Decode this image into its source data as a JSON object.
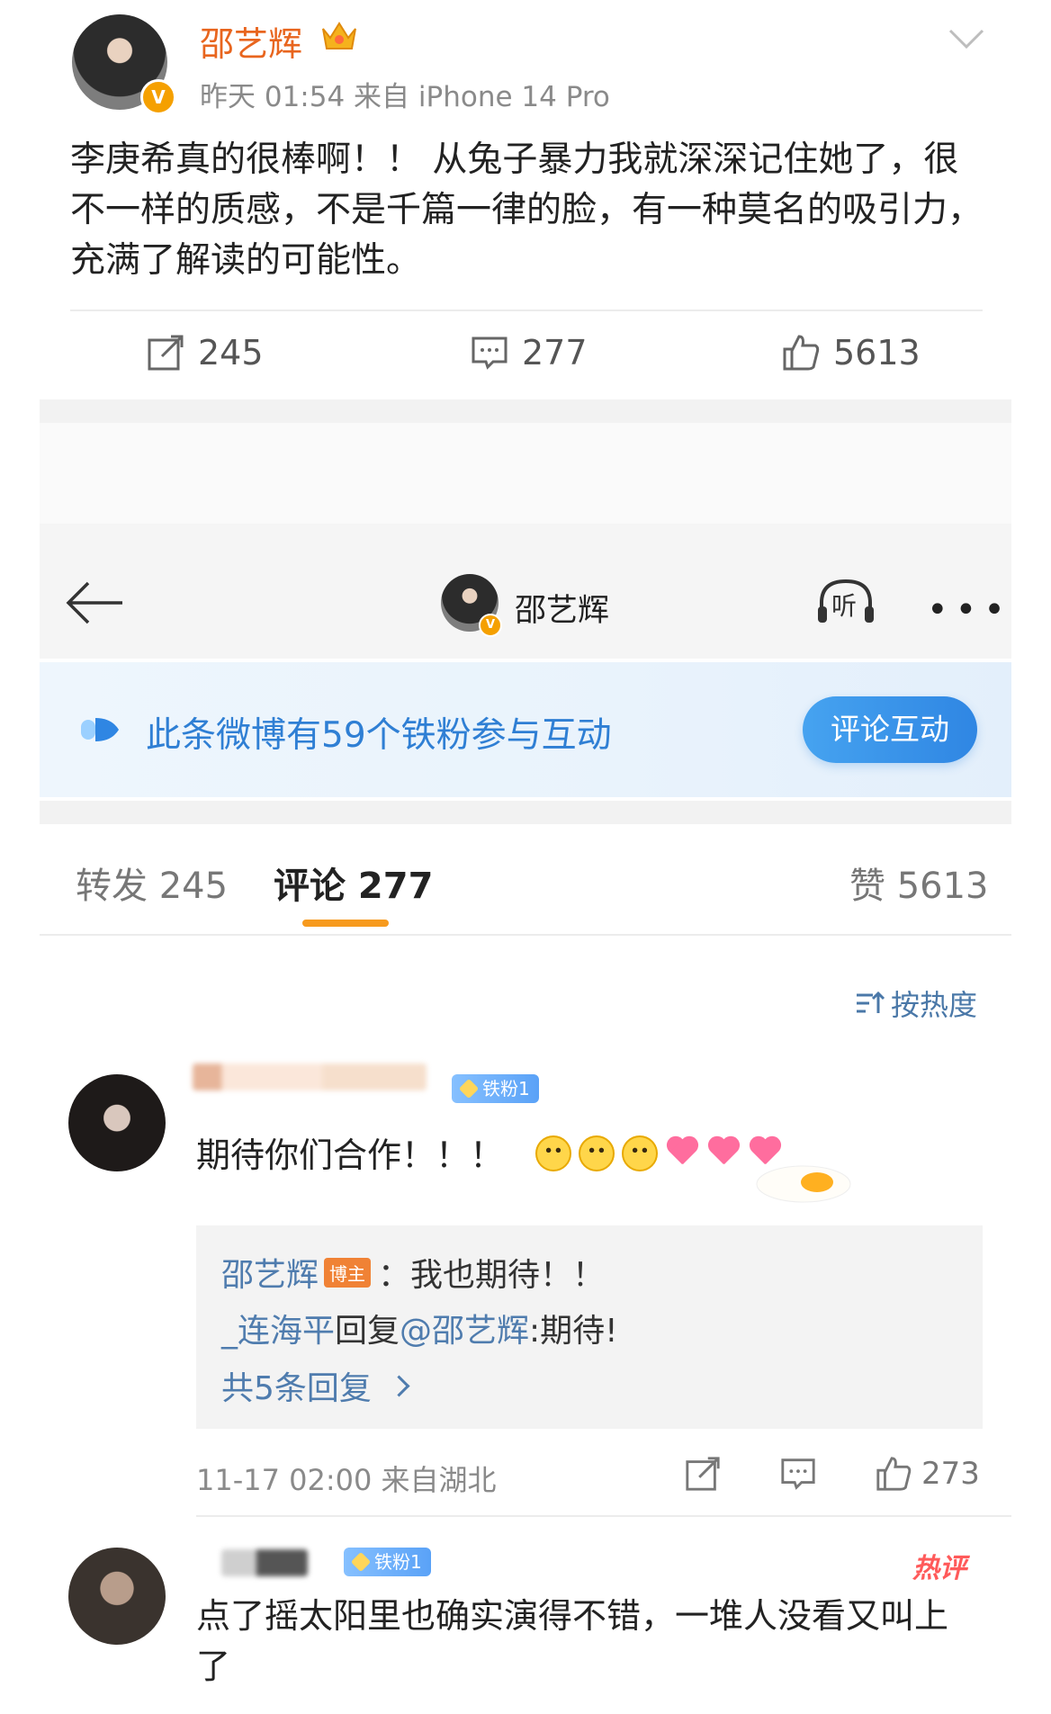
{
  "post": {
    "author": "邵艺辉",
    "meta": "昨天 01:54  来自 iPhone 14 Pro",
    "text": "李庚希真的很棒啊！！ 从兔子暴力我就深深记住她了，很不一样的质感，不是千篇一律的脸，有一种莫名的吸引力，充满了解读的可能性。",
    "repost_count": "245",
    "comment_count": "277",
    "like_count": "5613",
    "verified_badge": "V"
  },
  "detail_header": {
    "name": "邵艺辉",
    "listen_label": "听",
    "more": "•••"
  },
  "banner": {
    "text": "此条微博有59个铁粉参与互动",
    "button": "评论互动"
  },
  "tabs": {
    "repost": "转发 245",
    "comments": "评论 277",
    "likes": "赞 5613"
  },
  "sort": {
    "label": "按热度"
  },
  "comments": [
    {
      "fan_badge": "铁粉1",
      "text": "期待你们合作！！！",
      "replies": [
        {
          "user": "邵艺辉",
          "tag": "博主",
          "text": "：我也期待！！"
        },
        {
          "user": "_连海平",
          "text_prefix": "回复",
          "mention": "@邵艺辉",
          "text": ":期待!"
        }
      ],
      "more_replies": "共5条回复",
      "meta": "11-17 02:00  来自湖北",
      "like_count": "273"
    },
    {
      "fan_badge": "铁粉1",
      "hot_label": "热评",
      "text": "点了摇太阳里也确实演得不错，一堆人没看又叫上了"
    }
  ],
  "colors": {
    "author_orange": "#e8651e",
    "link_blue": "#4f7cae",
    "banner_blue": "#2f7fd4",
    "tab_underline": "#f79a1e",
    "hot_red": "#ff5a5a"
  }
}
